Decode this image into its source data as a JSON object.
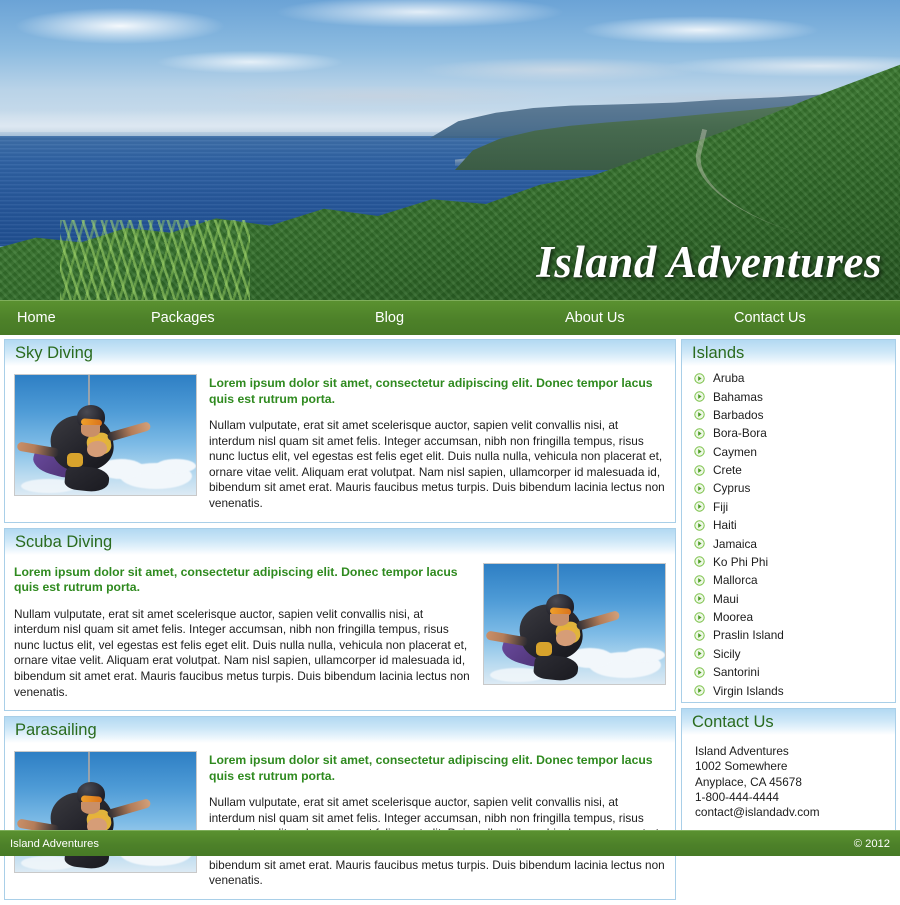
{
  "site": {
    "title": "Island Adventures"
  },
  "nav": {
    "items": [
      {
        "label": "Home"
      },
      {
        "label": "Packages"
      },
      {
        "label": "Blog"
      },
      {
        "label": "About Us"
      },
      {
        "label": "Contact Us"
      }
    ]
  },
  "articles": [
    {
      "heading": "Sky Diving",
      "image_alt": "tandem-skydivers-photo",
      "image_side": "left",
      "lead": "Lorem ipsum dolor sit amet, consectetur adipiscing elit. Donec tempor lacus quis est rutrum porta.",
      "body": "Nullam vulputate, erat sit amet scelerisque auctor, sapien velit convallis nisi, at interdum nisl quam sit amet felis. Integer accumsan, nibh non fringilla tempus, risus nunc luctus elit, vel egestas est felis eget elit. Duis nulla nulla, vehicula non placerat et, ornare vitae velit. Aliquam erat volutpat. Nam nisl sapien, ullamcorper id malesuada id, bibendum sit amet erat. Mauris faucibus metus turpis. Duis bibendum lacinia lectus non venenatis."
    },
    {
      "heading": "Scuba Diving",
      "image_alt": "tandem-skydivers-photo",
      "image_side": "right",
      "lead": "Lorem ipsum dolor sit amet, consectetur adipiscing elit. Donec tempor lacus quis est rutrum porta.",
      "body": "Nullam vulputate, erat sit amet scelerisque auctor, sapien velit convallis nisi, at interdum nisl quam sit amet felis. Integer accumsan, nibh non fringilla tempus, risus nunc luctus elit, vel egestas est felis eget elit. Duis nulla nulla, vehicula non placerat et, ornare vitae velit. Aliquam erat volutpat. Nam nisl sapien, ullamcorper id malesuada id, bibendum sit amet erat. Mauris faucibus metus turpis. Duis bibendum lacinia lectus non venenatis."
    },
    {
      "heading": "Parasailing",
      "image_alt": "tandem-skydivers-photo",
      "image_side": "left",
      "lead": "Lorem ipsum dolor sit amet, consectetur adipiscing elit. Donec tempor lacus quis est rutrum porta.",
      "body": "Nullam vulputate, erat sit amet scelerisque auctor, sapien velit convallis nisi, at interdum nisl quam sit amet felis. Integer accumsan, nibh non fringilla tempus, risus nunc luctus elit, vel egestas est felis eget elit. Duis nulla nulla, vehicula non placerat et, ornare vitae velit. Aliquam erat volutpat. Nam nisl sapien, ullamcorper id malesuada id, bibendum sit amet erat. Mauris faucibus metus turpis. Duis bibendum lacinia lectus non venenatis."
    }
  ],
  "sidebar": {
    "islands": {
      "heading": "Islands",
      "bullet_icon": "circle-arrow-right-icon",
      "items": [
        "Aruba",
        "Bahamas",
        "Barbados",
        "Bora-Bora",
        "Caymen",
        "Crete",
        "Cyprus",
        "Fiji",
        "Haiti",
        "Jamaica",
        "Ko Phi Phi",
        "Mallorca",
        "Maui",
        "Moorea",
        "Praslin Island",
        "Sicily",
        "Santorini",
        "Virgin Islands"
      ]
    },
    "contact": {
      "heading": "Contact Us",
      "lines": [
        "Island Adventures",
        "1002 Somewhere",
        "Anyplace, CA 45678",
        "1-800-444-4444",
        "contact@islandadv.com"
      ]
    }
  },
  "footer": {
    "left": "Island Adventures",
    "right": "© 2012"
  },
  "colors": {
    "nav_green": "#4d8129",
    "heading_green": "#2a6b1e",
    "lead_green": "#2f8a1f",
    "panel_border_blue": "#a9cfe8",
    "panel_head_blue": "#b3d9f2"
  }
}
